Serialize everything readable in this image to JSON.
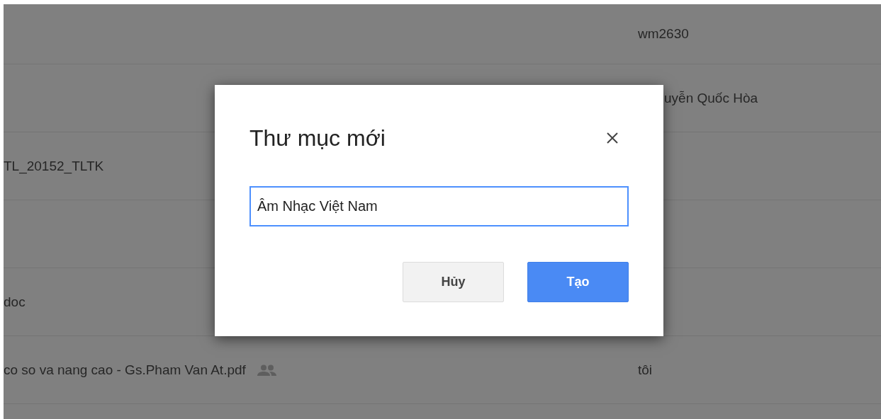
{
  "file_list": {
    "rows": [
      {
        "owner": "wm2630"
      },
      {
        "owner": "uyễn Quốc Hòa",
        "partly_hidden": true
      },
      {
        "name": "TL_20152_TLTK",
        "shared": false
      },
      {},
      {
        "name": "doc",
        "shared": false
      },
      {
        "name": "co so va nang cao - Gs.Pham Van At.pdf",
        "shared": true,
        "owner": "tôi"
      },
      {}
    ]
  },
  "dialog": {
    "title": "Thư mục mới",
    "name_field": {
      "value": "Âm Nhạc Việt Nam",
      "focused": true
    },
    "buttons": [
      {
        "label": "Hủy",
        "kind": "secondary"
      },
      {
        "label": "Tạo",
        "kind": "primary"
      }
    ]
  }
}
